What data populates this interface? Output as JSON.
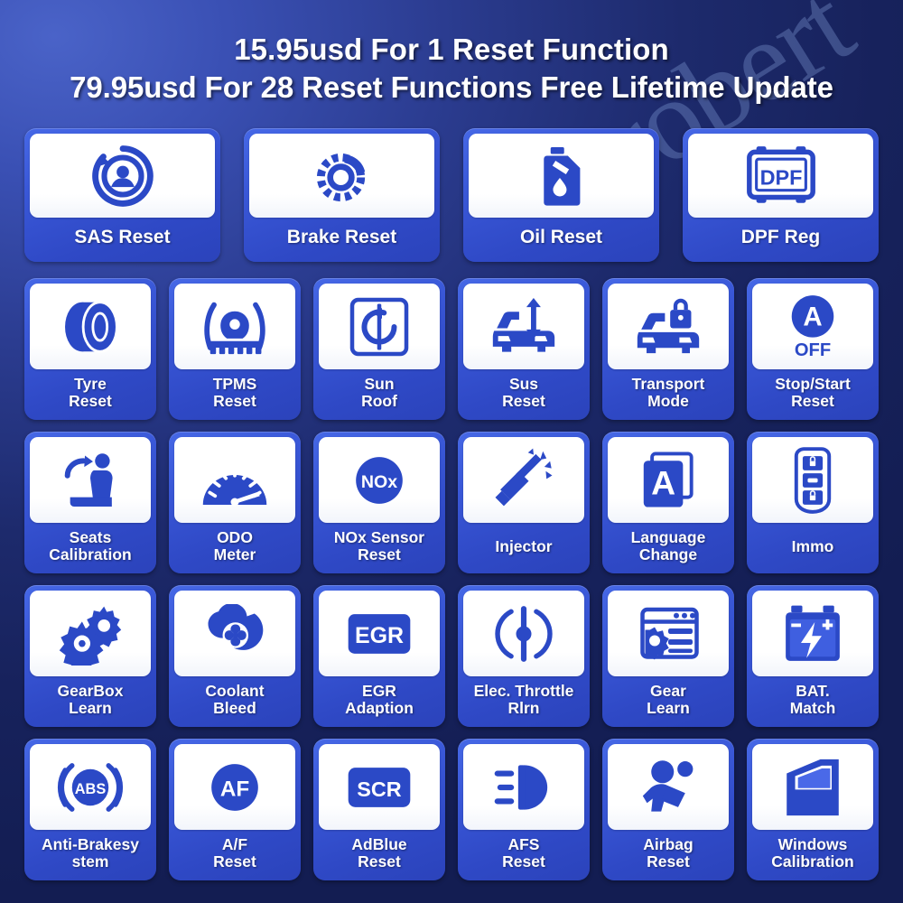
{
  "watermark": "robert",
  "headline": {
    "line1": "15.95usd For 1 Reset Function",
    "line2": "79.95usd  For 28 Reset Functions Free Lifetime Update"
  },
  "colors": {
    "card_blue": "#3a58d8",
    "icon_blue": "#2b49c6",
    "panel_white": "#ffffff",
    "bg_dark_navy": "#131d52",
    "bg_light_blue": "#4a63c8",
    "label_white": "#ffffff"
  },
  "rows": [
    {
      "size": "big",
      "cards": [
        {
          "icon": "sas-steering-icon",
          "label": "SAS Reset",
          "label_lines": [
            "SAS Reset"
          ]
        },
        {
          "icon": "brake-disc-icon",
          "label": "Brake Reset",
          "label_lines": [
            "Brake Reset"
          ]
        },
        {
          "icon": "oil-can-icon",
          "label": "Oil Reset",
          "label_lines": [
            "Oil Reset"
          ]
        },
        {
          "icon": "dpf-filter-icon",
          "label": "DPF Reg",
          "label_lines": [
            "DPF Reg"
          ],
          "badge": "DPF"
        }
      ]
    },
    {
      "size": "small",
      "cards": [
        {
          "icon": "tyre-icon",
          "label": "Tyre Reset",
          "label_lines": [
            "Tyre",
            "Reset"
          ]
        },
        {
          "icon": "tpms-gear-icon",
          "label": "TPMS Reset",
          "label_lines": [
            "TPMS",
            "Reset"
          ]
        },
        {
          "icon": "sun-roof-icon",
          "label": "Sun Roof",
          "label_lines": [
            "Sun",
            "Roof"
          ]
        },
        {
          "icon": "suspension-car-icon",
          "label": "Sus Reset",
          "label_lines": [
            "Sus",
            "Reset"
          ]
        },
        {
          "icon": "transport-lock-car-icon",
          "label": "Transport Mode",
          "label_lines": [
            "Transport",
            "Mode"
          ]
        },
        {
          "icon": "stop-start-a-off-icon",
          "label": "Stop/Start Reset",
          "label_lines": [
            "Stop/Start",
            "Reset"
          ],
          "badge": "A",
          "badge_sub": "OFF"
        }
      ]
    },
    {
      "size": "small",
      "cards": [
        {
          "icon": "seat-calibration-icon",
          "label": "Seats Calibration",
          "label_lines": [
            "Seats",
            "Calibration"
          ]
        },
        {
          "icon": "odometer-gauge-icon",
          "label": "ODO Meter",
          "label_lines": [
            "ODO",
            "Meter"
          ]
        },
        {
          "icon": "nox-sensor-icon",
          "label": "NOx Sensor Reset",
          "label_lines": [
            "NOx Sensor",
            "Reset"
          ],
          "badge": "NOx"
        },
        {
          "icon": "injector-icon",
          "label": "Injector",
          "label_lines": [
            "Injector"
          ]
        },
        {
          "icon": "language-book-a-icon",
          "label": "Language Change",
          "label_lines": [
            "Language",
            "Change"
          ],
          "badge": "A"
        },
        {
          "icon": "immo-key-fob-icon",
          "label": "Immo",
          "label_lines": [
            "Immo"
          ]
        }
      ]
    },
    {
      "size": "small",
      "cards": [
        {
          "icon": "gearbox-gears-icon",
          "label": "GearBox Learn",
          "label_lines": [
            "GearBox",
            "Learn"
          ]
        },
        {
          "icon": "coolant-pump-icon",
          "label": "Coolant Bleed",
          "label_lines": [
            "Coolant",
            "Bleed"
          ]
        },
        {
          "icon": "egr-valve-icon",
          "label": "EGR Adaption",
          "label_lines": [
            "EGR",
            "Adaption"
          ],
          "badge": "EGR"
        },
        {
          "icon": "elec-throttle-icon",
          "label": "Elec. Throttle Rlrn",
          "label_lines": [
            "Elec. Throttle",
            "Rlrn"
          ]
        },
        {
          "icon": "gear-learn-screen-icon",
          "label": "Gear Learn",
          "label_lines": [
            "Gear",
            "Learn"
          ]
        },
        {
          "icon": "battery-match-icon",
          "label": "BAT. Match",
          "label_lines": [
            "BAT.",
            "Match"
          ]
        }
      ]
    },
    {
      "size": "small",
      "cards": [
        {
          "icon": "abs-brake-icon",
          "label": "Anti-Brakesystem",
          "label_lines": [
            "Anti-Brakesy",
            "stem"
          ],
          "badge": "ABS"
        },
        {
          "icon": "af-reset-icon",
          "label": "A/F Reset",
          "label_lines": [
            "A/F",
            "Reset"
          ],
          "badge": "AF"
        },
        {
          "icon": "scr-adblue-icon",
          "label": "AdBlue Reset",
          "label_lines": [
            "AdBlue",
            "Reset"
          ],
          "badge": "SCR"
        },
        {
          "icon": "afs-headlight-icon",
          "label": "AFS Reset",
          "label_lines": [
            "AFS",
            "Reset"
          ]
        },
        {
          "icon": "airbag-icon",
          "label": "Airbag Reset",
          "label_lines": [
            "Airbag",
            "Reset"
          ]
        },
        {
          "icon": "car-window-icon",
          "label": "Windows Calibration",
          "label_lines": [
            "Windows",
            "Calibration"
          ]
        }
      ]
    }
  ]
}
